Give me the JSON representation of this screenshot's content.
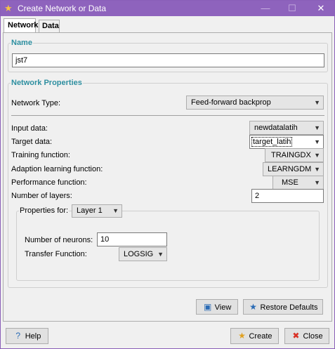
{
  "window": {
    "title": "Create Network or Data",
    "icon": "star-icon"
  },
  "tabs": [
    {
      "label": "Network"
    },
    {
      "label": "Data"
    }
  ],
  "name_group": {
    "title": "Name",
    "value": "jst7"
  },
  "props_group": {
    "title": "Network Properties",
    "network_type_label": "Network Type:",
    "network_type_value": "Feed-forward backprop",
    "input_label": "Input data:",
    "input_value": "newdatalatih",
    "target_label": "Target data:",
    "target_value": "target_latih",
    "training_label": "Training function:",
    "training_value": "TRAINGDX",
    "adaption_label": "Adaption learning function:",
    "adaption_value": "LEARNGDM",
    "performance_label": "Performance function:",
    "performance_value": "MSE",
    "layers_label": "Number of layers:",
    "layers_value": "2"
  },
  "layer_group": {
    "title": "Properties for:",
    "layer_value": "Layer 1",
    "neurons_label": "Number of neurons:",
    "neurons_value": "10",
    "transfer_label": "Transfer Function:",
    "transfer_value": "LOGSIG"
  },
  "buttons": {
    "view": "View",
    "restore": "Restore Defaults",
    "help": "Help",
    "create": "Create",
    "close": "Close"
  }
}
